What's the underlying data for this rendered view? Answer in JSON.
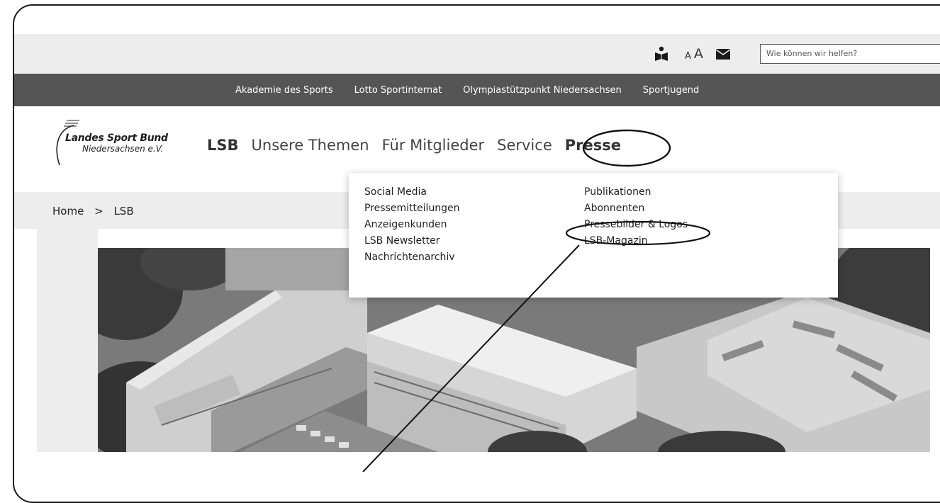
{
  "topbar": {
    "font_size_small": "A",
    "font_size_large": "A",
    "search_placeholder": "Wie können wir helfen?"
  },
  "top_nav": [
    "Akademie des Sports",
    "Lotto Sportinternat",
    "Olympiastützpunkt Niedersachsen",
    "Sportjugend"
  ],
  "logo": {
    "line1": "Landes Sport Bund",
    "line2": "Niedersachsen e.V."
  },
  "main_nav": [
    "LSB",
    "Unsere Themen",
    "Für Mitglieder",
    "Service",
    "Presse"
  ],
  "breadcrumb": {
    "home": "Home",
    "separator": ">",
    "current": "LSB"
  },
  "dropdown": {
    "left": [
      "Social Media",
      "Pressemitteilungen",
      "Anzeigenkunden",
      "LSB Newsletter",
      "Nachrichtenarchiv"
    ],
    "right": [
      "Publikationen",
      "Abonnenten",
      "Pressebilder & Logos",
      "LSB-Magazin"
    ]
  },
  "icons": [
    "reader-icon",
    "mail-icon"
  ],
  "colors": {
    "dark_nav": "#555555",
    "light_band": "#ededed",
    "annotation": "#111111"
  }
}
